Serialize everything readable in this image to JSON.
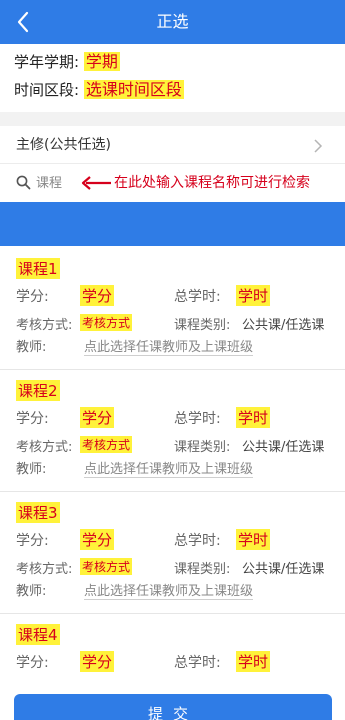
{
  "header": {
    "title": "正选"
  },
  "info": {
    "term_label": "学年学期:",
    "term_value": "学期",
    "period_label": "时间区段:",
    "period_value": "选课时间区段"
  },
  "category": {
    "label": "主修(公共任选)"
  },
  "search": {
    "placeholder": "课程",
    "annotation": "在此处输入课程名称可进行检索"
  },
  "labels": {
    "credit": "学分:",
    "hours": "总学时:",
    "exam": "考核方式:",
    "type": "课程类别:",
    "teacher": "教师:"
  },
  "courses": [
    {
      "name": "课程1",
      "credit": "学分",
      "hours": "学时",
      "exam": "考核方式",
      "type": "公共课/任选课",
      "teacher": "点此选择任课教师及上课班级"
    },
    {
      "name": "课程2",
      "credit": "学分",
      "hours": "学时",
      "exam": "考核方式",
      "type": "公共课/任选课",
      "teacher": "点此选择任课教师及上课班级"
    },
    {
      "name": "课程3",
      "credit": "学分",
      "hours": "学时",
      "exam": "考核方式",
      "type": "公共课/任选课",
      "teacher": "点此选择任课教师及上课班级"
    },
    {
      "name": "课程4",
      "credit": "学分",
      "hours": "学时"
    }
  ],
  "submit": {
    "label": "提交"
  },
  "colors": {
    "primary": "#2f7ce6",
    "highlight": "#fff23a",
    "annotation": "#d6001c"
  }
}
